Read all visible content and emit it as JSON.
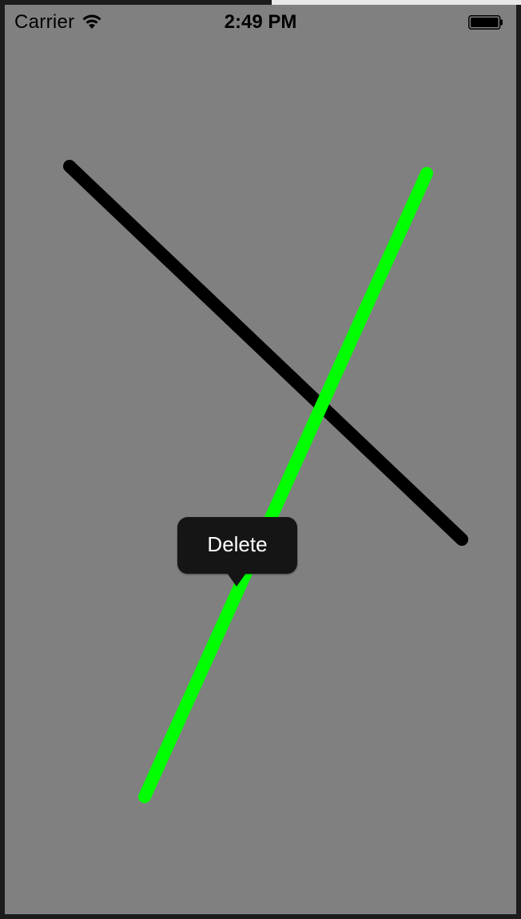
{
  "status_bar": {
    "carrier": "Carrier",
    "time": "2:49 PM",
    "wifi_icon": "wifi-icon",
    "battery_icon": "battery-full-icon"
  },
  "canvas": {
    "background": "#808080",
    "lines": [
      {
        "name": "black-line",
        "color": "#000000"
      },
      {
        "name": "green-line",
        "color": "#00ff00"
      }
    ]
  },
  "edit_menu": {
    "items": [
      {
        "label": "Delete"
      }
    ]
  }
}
